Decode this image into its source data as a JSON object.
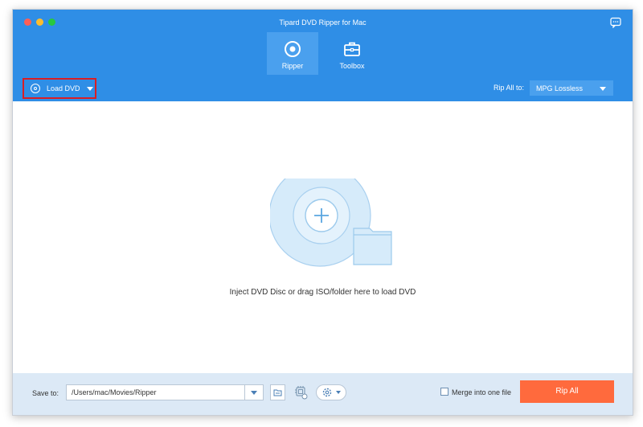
{
  "window": {
    "title": "Tipard DVD Ripper for Mac"
  },
  "tabs": [
    {
      "label": "Ripper",
      "active": true,
      "icon": "ripper-disc-icon"
    },
    {
      "label": "Toolbox",
      "active": false,
      "icon": "toolbox-icon"
    }
  ],
  "toolbar": {
    "load_dvd_label": "Load DVD",
    "rip_all_to_label": "Rip All to:",
    "rip_format": "MPG Lossless"
  },
  "drop_zone": {
    "hint": "Inject DVD Disc or drag ISO/folder here to load DVD"
  },
  "bottom_bar": {
    "save_to_label": "Save to:",
    "save_path": "/Users/mac/Movies/Ripper",
    "merge_label": "Merge into one file",
    "merge_checked": false,
    "rip_all_label": "Rip All"
  },
  "colors": {
    "header_bg": "#2f8ee6",
    "active_tab_bg": "#4aa0ee",
    "highlight_border": "#d91e25",
    "rip_button_bg": "#ff6a3d",
    "bottom_bar_bg": "#dce9f6",
    "art_light_blue": "#d6ebfa"
  }
}
